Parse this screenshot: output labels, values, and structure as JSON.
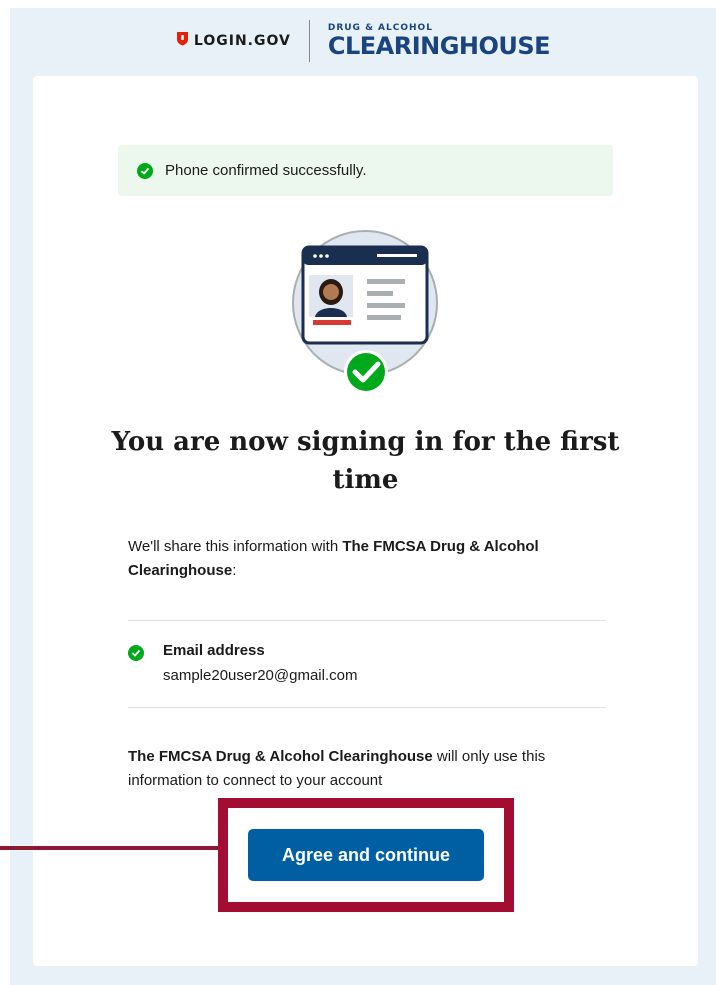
{
  "header": {
    "logingov_text": "LOGIN.GOV",
    "clearinghouse_small": "DRUG & ALCOHOL",
    "clearinghouse_big": "CLEARINGHOUSE"
  },
  "alert": {
    "text": "Phone confirmed successfully.",
    "icon": "check-circle-icon"
  },
  "main": {
    "title": "You are now signing in for the first time",
    "share_prefix": "We'll share this information with ",
    "share_bold": "The FMCSA Drug & Alcohol Clearinghouse",
    "share_suffix": ":",
    "attributes": [
      {
        "label": "Email address",
        "value": "sample20user20@gmail.com",
        "icon": "check-circle-icon"
      }
    ],
    "use_bold": "The FMCSA Drug & Alcohol Clearinghouse",
    "use_rest": " will only use this information to connect to your account",
    "cta_label": "Agree and continue"
  },
  "colors": {
    "page_bg": "#e8f0f8",
    "primary": "#005ea2",
    "success": "#00a91c",
    "alert_bg": "#ecf8ed",
    "highlight": "#a30d32",
    "brand_navy": "#1a4480"
  }
}
